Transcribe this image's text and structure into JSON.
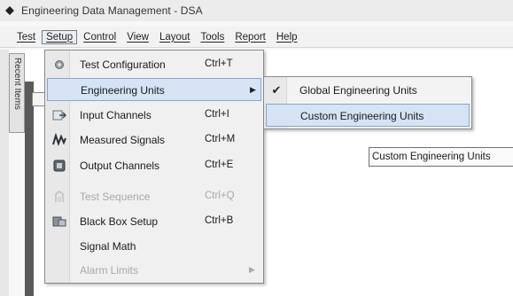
{
  "window": {
    "title": "Engineering Data Management - DSA",
    "app_icon": "app-logo-icon"
  },
  "menubar": {
    "items": [
      {
        "label": "Test"
      },
      {
        "label": "Setup",
        "active": true
      },
      {
        "label": "Control"
      },
      {
        "label": "View"
      },
      {
        "label": "Layout"
      },
      {
        "label": "Tools"
      },
      {
        "label": "Report"
      },
      {
        "label": "Help"
      }
    ]
  },
  "side_panel": {
    "tab_label": "Recent Items"
  },
  "setup_menu": {
    "items": [
      {
        "label": "Test Configuration",
        "shortcut": "Ctrl+T",
        "icon": "test-configuration-icon",
        "enabled": true
      },
      {
        "label": "Engineering Units",
        "shortcut": "",
        "icon": "",
        "enabled": true,
        "highlighted": true,
        "has_submenu": true
      },
      {
        "label": "Input Channels",
        "shortcut": "Ctrl+I",
        "icon": "input-channels-icon",
        "enabled": true
      },
      {
        "label": "Measured Signals",
        "shortcut": "Ctrl+M",
        "icon": "measured-signals-icon",
        "enabled": true
      },
      {
        "label": "Output Channels",
        "shortcut": "Ctrl+E",
        "icon": "output-channels-icon",
        "enabled": true
      },
      {
        "label": "Test Sequence",
        "shortcut": "Ctrl+Q",
        "icon": "test-sequence-icon",
        "enabled": false
      },
      {
        "label": "Black Box Setup",
        "shortcut": "Ctrl+B",
        "icon": "black-box-setup-icon",
        "enabled": true
      },
      {
        "label": "Signal Math",
        "shortcut": "",
        "icon": "",
        "enabled": true
      },
      {
        "label": "Alarm Limits",
        "shortcut": "",
        "icon": "",
        "enabled": false,
        "has_submenu": true
      }
    ],
    "submenu_arrow": "▶"
  },
  "engineering_units_submenu": {
    "items": [
      {
        "label": "Global Engineering Units",
        "checked": true
      },
      {
        "label": "Custom Engineering Units",
        "checked": false,
        "highlighted": true
      }
    ],
    "check_glyph": "✔"
  },
  "tooltip": {
    "text": "Custom Engineering Units"
  },
  "colors": {
    "highlight_bg": "#d5e3f5",
    "highlight_border": "#86a6cf",
    "disabled_text": "#a8a8a8",
    "menu_bg": "#f0f0f0"
  }
}
